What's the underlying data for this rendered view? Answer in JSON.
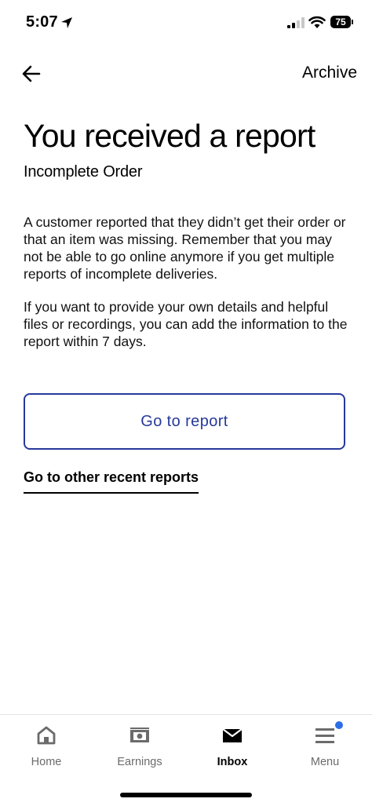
{
  "status_bar": {
    "time": "5:07",
    "battery": "75"
  },
  "header": {
    "archive_label": "Archive"
  },
  "main": {
    "title": "You received a report",
    "subtitle": "Incomplete Order",
    "paragraph_1": "A customer reported that they didn’t get their order or that an item was missing. Remember that you may not be able to go online anymore if you get multiple reports of incomplete deliveries.",
    "paragraph_2": "If you want to provide your own details and helpful files or recordings, you can add the information to the report within 7 days.",
    "report_button_label": "Go to report",
    "other_reports_label": "Go to other recent reports"
  },
  "bottom_nav": {
    "items": [
      {
        "label": "Home",
        "icon": "home-icon",
        "active": false
      },
      {
        "label": "Earnings",
        "icon": "earnings-icon",
        "active": false
      },
      {
        "label": "Inbox",
        "icon": "inbox-icon",
        "active": true
      },
      {
        "label": "Menu",
        "icon": "menu-icon",
        "active": false,
        "has_notification": true
      }
    ]
  },
  "colors": {
    "accent": "#27399a",
    "notification_dot": "#2d6de6",
    "inactive_nav": "#6b6b6b"
  }
}
